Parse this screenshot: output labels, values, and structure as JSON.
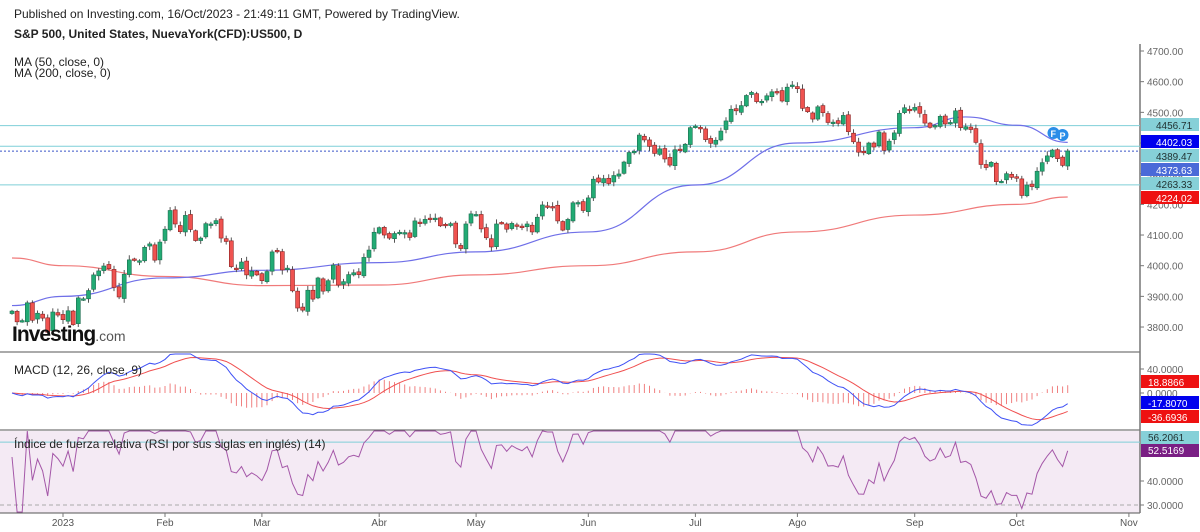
{
  "header": {
    "published": "Published on Investing.com, 16/Oct/2023 - 21:49:11 GMT, Powered by TradingView.",
    "title": "S&P 500, United States, NuevaYork(CFD):US500, D"
  },
  "legend": {
    "ma50": "MA (50, close, 0)",
    "ma200": "MA (200, close, 0)"
  },
  "logo": {
    "text": "Investing",
    "suffix": ".com"
  },
  "colors": {
    "up": "#22ab74",
    "down": "#ef5350",
    "ma50": "#6f6fe8",
    "ma200": "#f07a7a",
    "macd": "#3f51f5",
    "signal": "#f05050",
    "histogram": "#f08080",
    "rsi": "#a457a8",
    "rsi_bg": "#f4eaf4",
    "level_line": "#7fcfd8"
  },
  "chart_data": {
    "type": "candlestick",
    "panes": [
      {
        "name": "price",
        "ylim": [
          3750,
          4720
        ],
        "y_ticks": [
          "4700.00",
          "4600.00",
          "4500.00",
          "4400.00",
          "4300.00",
          "4200.00",
          "4100.00",
          "4000.00",
          "3900.00",
          "3800.00"
        ],
        "y_tick_values": [
          4700,
          4600,
          4500,
          4400,
          4300,
          4200,
          4100,
          4000,
          3900,
          3800
        ],
        "closes_by_month": [
          {
            "month": "2022-12",
            "closes": [
              3852,
              3817,
              3821,
              3879,
              3822,
              3845,
              3829,
              3783,
              3849,
              3839
            ]
          },
          {
            "month": "2023-01",
            "closes": [
              3824,
              3853,
              3808,
              3895,
              3892,
              3919,
              3970,
              3983,
              3999,
              3990,
              3929,
              3898,
              3972,
              4019,
              4017,
              4016,
              4060,
              4071,
              4018,
              4077
            ]
          },
          {
            "month": "2023-02",
            "closes": [
              4119,
              4180,
              4136,
              4111,
              4164,
              4118,
              4082,
              4090,
              4137,
              4136,
              4147,
              4090,
              4079,
              3997,
              3991,
              4012,
              3970,
              3982,
              3970
            ]
          },
          {
            "month": "2023-03",
            "closes": [
              3951,
              3981,
              4045,
              4048,
              3986,
              3992,
              3918,
              3862,
              3855,
              3920,
              3891,
              3960,
              3917,
              3951,
              4002,
              3937,
              3948,
              3971,
              3977,
              3971,
              4027,
              4051,
              4109
            ]
          },
          {
            "month": "2023-04",
            "closes": [
              4124,
              4100,
              4090,
              4105,
              4109,
              4108,
              4092,
              4146,
              4138,
              4151,
              4154,
              4155,
              4130,
              4133,
              4137,
              4071,
              4056,
              4136,
              4169
            ]
          },
          {
            "month": "2023-05",
            "closes": [
              4167,
              4120,
              4091,
              4061,
              4136,
              4138,
              4119,
              4138,
              4130,
              4124,
              4136,
              4110,
              4158,
              4198,
              4192,
              4192,
              4146,
              4116,
              4151,
              4205,
              4206,
              4180
            ]
          },
          {
            "month": "2023-06",
            "closes": [
              4221,
              4282,
              4273,
              4284,
              4268,
              4294,
              4299,
              4338,
              4369,
              4373,
              4426,
              4410,
              4389,
              4366,
              4381,
              4348,
              4328,
              4378,
              4376,
              4396,
              4450
            ]
          },
          {
            "month": "2023-07",
            "closes": [
              4455,
              4446,
              4411,
              4399,
              4409,
              4439,
              4472,
              4510,
              4505,
              4522,
              4555,
              4565,
              4535,
              4536,
              4554,
              4567,
              4566,
              4537,
              4582,
              4589
            ]
          },
          {
            "month": "2023-08",
            "closes": [
              4577,
              4513,
              4502,
              4478,
              4518,
              4499,
              4467,
              4468,
              4464,
              4490,
              4437,
              4404,
              4370,
              4369,
              4400,
              4387,
              4436,
              4376,
              4406,
              4433,
              4497,
              4515,
              4508
            ]
          },
          {
            "month": "2023-09",
            "closes": [
              4516,
              4497,
              4465,
              4451,
              4457,
              4487,
              4462,
              4467,
              4505,
              4450,
              4453,
              4444,
              4402,
              4330,
              4320,
              4337,
              4274,
              4275,
              4300,
              4288
            ]
          },
          {
            "month": "2023-10",
            "closes": [
              4288,
              4229,
              4263,
              4258,
              4308,
              4336,
              4358,
              4377,
              4349,
              4327,
              4374
            ]
          }
        ],
        "ma50_by_month": [
          [
            "2022-12",
            3870
          ],
          [
            "2023-01",
            3900
          ],
          [
            "2023-02",
            3960
          ],
          [
            "2023-03",
            3985
          ],
          [
            "2023-04",
            4010
          ],
          [
            "2023-05",
            4045
          ],
          [
            "2023-06",
            4110
          ],
          [
            "2023-07",
            4263
          ],
          [
            "2023-08",
            4400
          ],
          [
            "2023-09",
            4450
          ],
          [
            "2023-09-mid",
            4485
          ],
          [
            "2023-10",
            4458
          ],
          [
            "end",
            4402.03
          ]
        ],
        "ma200_by_month": [
          [
            "2022-12",
            4025
          ],
          [
            "2023-01",
            4000
          ],
          [
            "2023-02",
            3965
          ],
          [
            "2023-03",
            3935
          ],
          [
            "2023-04",
            3937
          ],
          [
            "2023-05",
            3970
          ],
          [
            "2023-06",
            4000
          ],
          [
            "2023-07",
            4045
          ],
          [
            "2023-08",
            4110
          ],
          [
            "2023-09",
            4165
          ],
          [
            "2023-10",
            4200
          ],
          [
            "end",
            4224.02
          ]
        ],
        "levels": [
          4456.71,
          4389.47,
          4263.33
        ],
        "last_close": 4373.63,
        "axis_labels": [
          {
            "text": "4456.71",
            "kind": "level"
          },
          {
            "text": "4402.03",
            "kind": "ma50"
          },
          {
            "text": "4389.47",
            "kind": "level"
          },
          {
            "text": "4373.63",
            "kind": "last"
          },
          {
            "text": "4263.33",
            "kind": "level"
          },
          {
            "text": "4224.02",
            "kind": "ma200"
          }
        ],
        "marker": "F P"
      },
      {
        "name": "macd",
        "title": "MACD (12, 26, close, 9)",
        "ylim": [
          -60,
          65
        ],
        "y_ticks": [
          "40.0000",
          "0.0000"
        ],
        "y_tick_values": [
          40,
          0
        ],
        "last": {
          "histogram": "18.8866",
          "macd": "-17.8070",
          "signal": "-36.6936"
        }
      },
      {
        "name": "rsi",
        "title": "Índice de fuerza relativa (RSI por sus siglas en inglés) (14)",
        "ylim": [
          27,
          61
        ],
        "y_ticks": [
          "40.0000",
          "30.0000"
        ],
        "y_tick_values": [
          40,
          30
        ],
        "band": [
          30,
          70
        ],
        "level": "56.2061",
        "last": "52.5169"
      }
    ],
    "x_labels": [
      "2023",
      "Feb",
      "Mar",
      "Abr",
      "May",
      "Jun",
      "Jul",
      "Ago",
      "Sep",
      "Oct",
      "Nov"
    ]
  }
}
